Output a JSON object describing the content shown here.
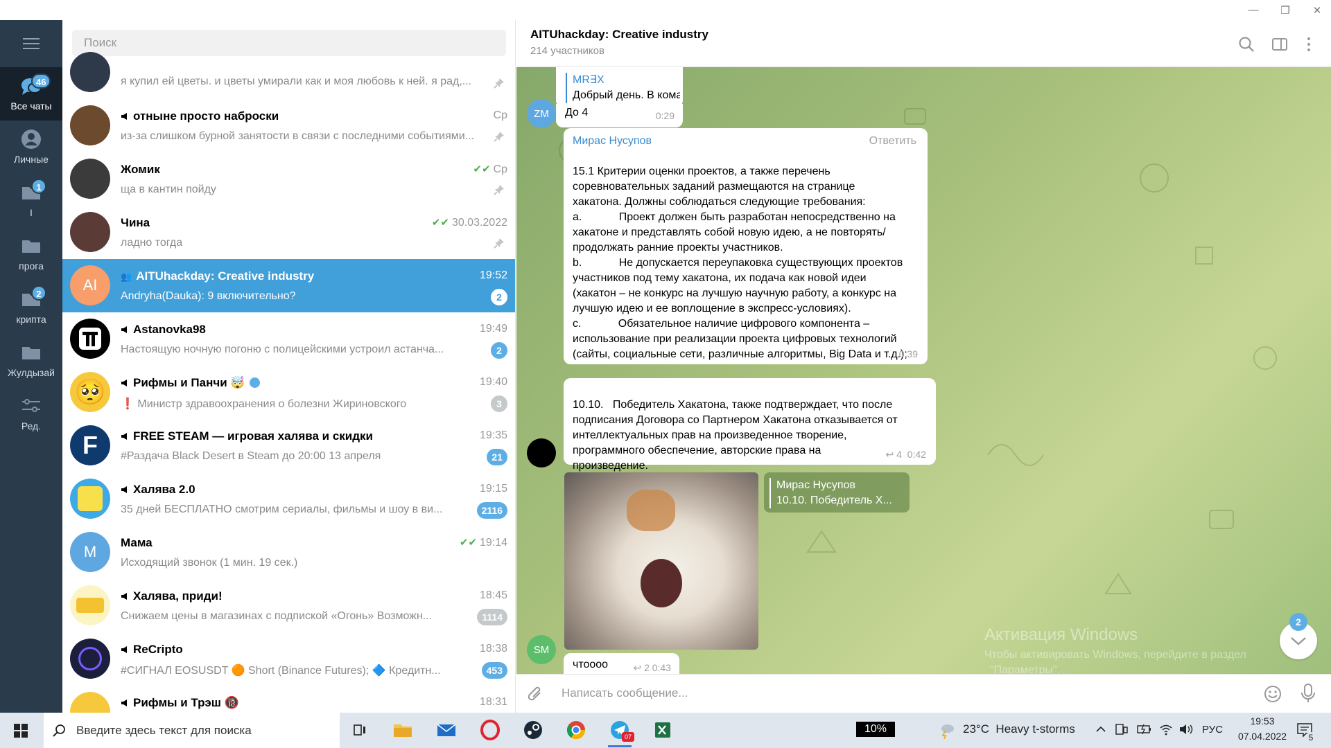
{
  "window": {
    "minimize": "—",
    "restore": "❐",
    "close": "✕"
  },
  "folders": [
    {
      "label": "Все чаты",
      "badge": "46",
      "icon": "chats-icon"
    },
    {
      "label": "Личные",
      "badge": "",
      "icon": "person-icon"
    },
    {
      "label": "I",
      "badge": "1",
      "icon": "folder-icon"
    },
    {
      "label": "прога",
      "badge": "",
      "icon": "folder-icon"
    },
    {
      "label": "крипта",
      "badge": "2",
      "icon": "folder-icon"
    },
    {
      "label": "Жулдызай",
      "badge": "",
      "icon": "folder-icon"
    },
    {
      "label": "Ред.",
      "badge": "",
      "icon": "edit-folders-icon"
    }
  ],
  "search": {
    "placeholder": "Поиск"
  },
  "chats": [
    {
      "name": "",
      "time": "",
      "preview": "я купил ей цветы. и цветы умирали как и моя любовь к ней. я рад,...",
      "badge": "",
      "pinned": true
    },
    {
      "name": "отныне просто наброски",
      "time": "Ср",
      "preview": "из-за слишком бурной занятости в связи с последними событиями...",
      "badge": "",
      "pinned": true
    },
    {
      "name": "Жомик",
      "time": "Ср",
      "preview": "ща в кантин пойду",
      "badge": "",
      "pinned": true,
      "read": true
    },
    {
      "name": "Чина",
      "time": "30.03.2022",
      "preview": "ладно тогда",
      "badge": "",
      "pinned": true,
      "read": true
    },
    {
      "name": "AITUhackday: Creative industry",
      "time": "19:52",
      "preview": "Andryha(Dauka): 9 включительно?",
      "badge": "2",
      "avatar_text": "AI"
    },
    {
      "name": "Astanovka98",
      "time": "19:49",
      "preview": "Настоящую ночную погоню с полицейскими устроил астанча...",
      "badge": "2"
    },
    {
      "name": "Рифмы и Панчи 🤯",
      "time": "19:40",
      "preview": "❗ Министр здравоохранения о болезни Жириновского",
      "badge": "3",
      "muted": true
    },
    {
      "name": "FREE STEAM — игровая халява и скидки",
      "time": "19:35",
      "preview": "#Раздача Black Desert в Steam до 20:00 13 апреля",
      "badge": "21"
    },
    {
      "name": "Халява 2.0",
      "time": "19:15",
      "preview": "35 дней БЕСПЛАТНО смотрим сериалы, фильмы и шоу в ви...",
      "badge": "2116"
    },
    {
      "name": "Мама",
      "time": "19:14",
      "preview": "Исходящий звонок (1 мин. 19 сек.)",
      "badge": "",
      "avatar_text": "M",
      "read": true
    },
    {
      "name": "Халява, приди!",
      "time": "18:45",
      "preview": "Снижаем цены в магазинах с подпиской «Огонь»  Возможн...",
      "badge": "1114",
      "muted": true
    },
    {
      "name": "ReCripto",
      "time": "18:38",
      "preview": "#СИГНАЛ EOSUSDT 🟠 Short (Binance Futures);  🔷 Кредитн...",
      "badge": "453"
    },
    {
      "name": "Рифмы и Трэш 🔞",
      "time": "18:31",
      "preview": "",
      "badge": ""
    }
  ],
  "chat": {
    "title": "AITUhackday: Creative industry",
    "subtitle": "214 участников",
    "messages": {
      "m1": {
        "reply_name": "MR∃X",
        "reply_text": "Добрый день. В кома...",
        "text": "До 4",
        "time": "0:29",
        "avatar": "ZM"
      },
      "m2": {
        "sender": "Мирас Нусупов",
        "reply_action": "Ответить",
        "time": "0:39",
        "lines": [
          "15.1 Критерии оценки проектов, а также перечень",
          "соревновательных заданий размещаются на странице",
          "хакатона. Должны соблюдаться следующие требования:",
          "a.            Проект должен быть разработан непосредственно на",
          "хакатоне и представлять собой новую идею, а не повторять/",
          "продолжать ранние проекты участников.",
          "b.            Не допускается переупаковка существующих проектов",
          "участников под тему хакатона, их подача как новой идеи",
          "(хакатон – не конкурс на лучшую научную работу, а конкурс на",
          "лучшую идею и ее воплощение в экспресс-условиях).",
          "c.            Обязательное наличие цифрового компонента –",
          "использование при реализации проекта цифровых технологий",
          "(сайты, социальные сети, различные алгоритмы, Big Data и т.д.);"
        ]
      },
      "m3": {
        "lines": [
          "10.10.   Победитель Хакатона, также подтверждает, что после",
          "подписания Договора со Партнером Хакатона отказывается от",
          "интеллектуальных прав на произведенное творение,",
          "программного обеспечение, авторские права на",
          "произведение."
        ],
        "replies": "4",
        "time": "0:42"
      },
      "m4": {
        "reply_name": "Мирас Нусупов",
        "reply_text": "10.10.   Победитель Х...",
        "avatar": "SM"
      },
      "m5": {
        "text": "чтоооо",
        "replies": "2",
        "time": "0:43"
      }
    },
    "scroll_badge": "2",
    "composer_placeholder": "Написать сообщение...",
    "watermark_1": "Активация Windows",
    "watermark_2": "Чтобы активировать Windows, перейдите в раздел",
    "watermark_3": "\"Параметры\"."
  },
  "taskbar": {
    "search_placeholder": "Введите здесь текст для поиска",
    "battery": "10%",
    "weather": "23°C  Heavy t-storms",
    "lang": "РУС",
    "time": "19:53",
    "date": "07.04.2022",
    "notif": "5",
    "telegram_badge": "07"
  },
  "colors": {
    "accent": "#419fd9",
    "badge": "#5eaee6",
    "sidebar": "#2a3b4c",
    "sender": "#3a8bd1"
  }
}
